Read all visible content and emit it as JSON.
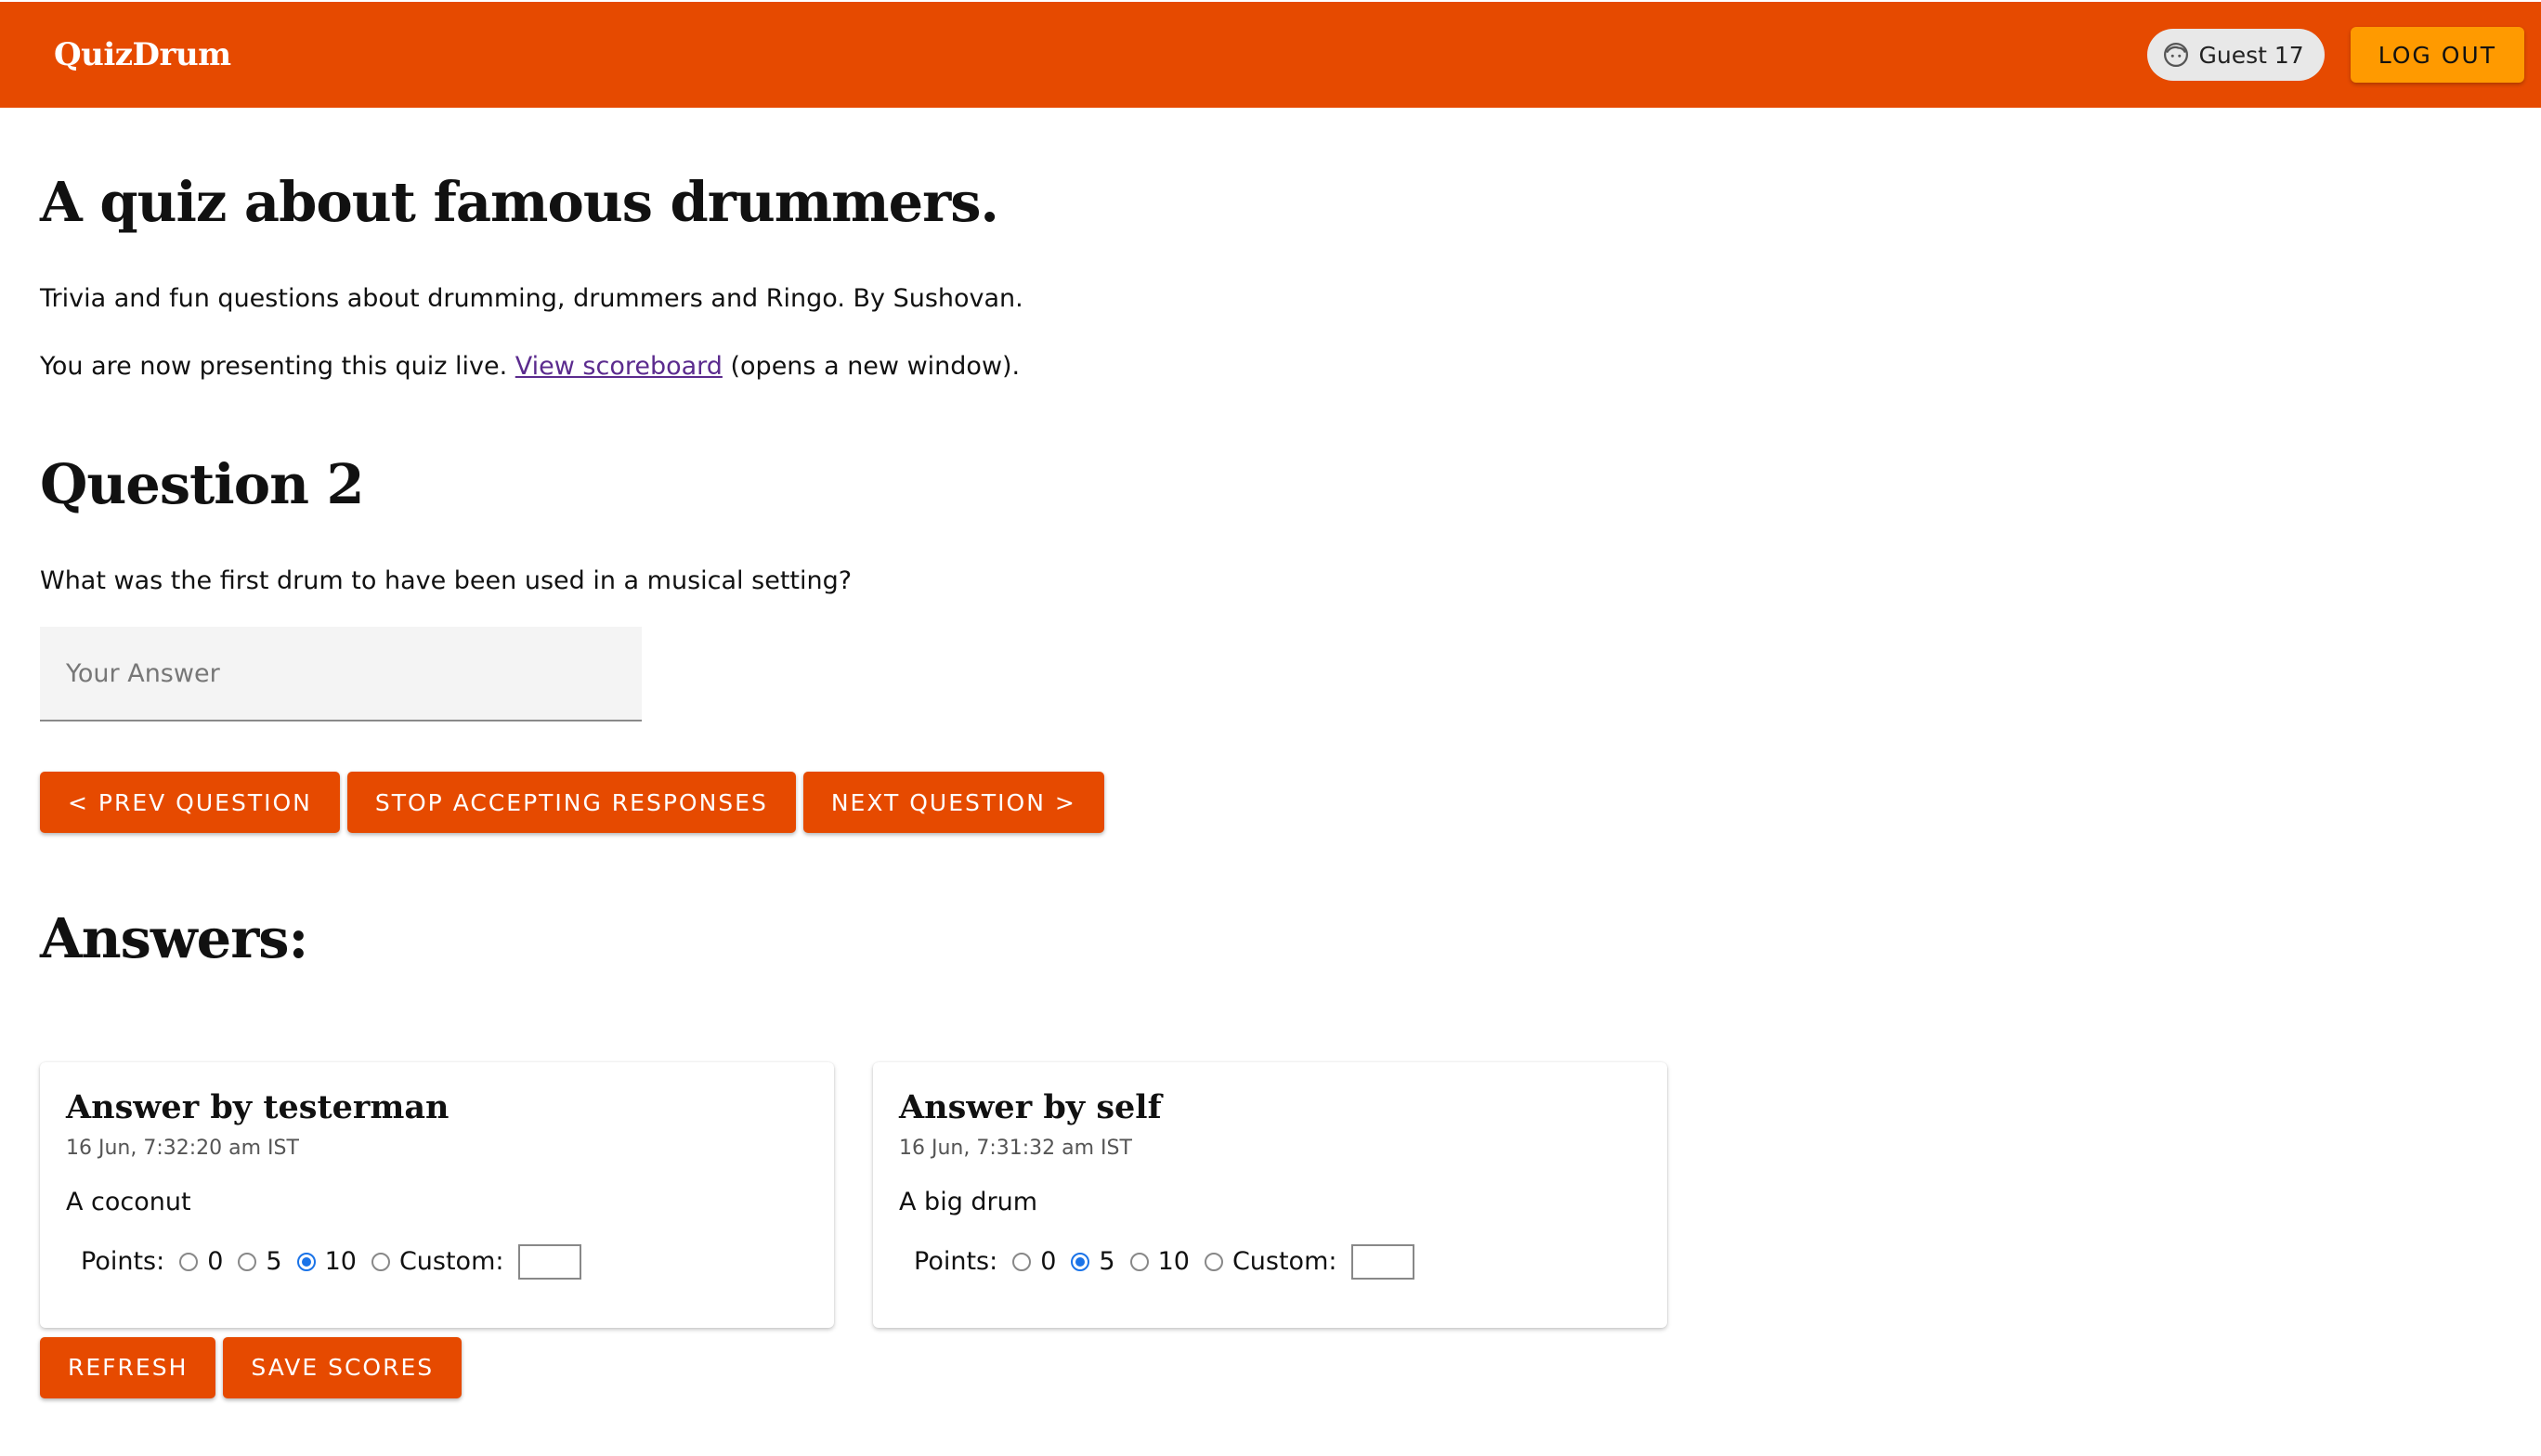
{
  "header": {
    "brand": "QuizDrum",
    "user_name": "Guest 17",
    "user_icon": "face-icon",
    "logout_label": "LOG OUT",
    "bar_color": "#e64a00",
    "logout_color": "#ff9a00"
  },
  "quiz": {
    "title": "A quiz about famous drummers.",
    "description": "Trivia and fun questions about drumming, drummers and Ringo. By Sushovan.",
    "live_prefix": "You are now presenting this quiz live. ",
    "scoreboard_link": "View scoreboard",
    "live_suffix": " (opens a new window)."
  },
  "question": {
    "title": "Question 2",
    "text": "What was the first drum to have been used in a musical setting?",
    "answer_placeholder": "Your Answer",
    "prev_label": "< PREV QUESTION",
    "stop_label": "STOP ACCEPTING RESPONSES",
    "next_label": "NEXT QUESTION >"
  },
  "answers": {
    "title": "Answers:",
    "points_label": "Points:",
    "custom_label": "Custom:",
    "items": [
      {
        "title": "Answer by testerman",
        "time": "16 Jun, 7:32:20 am IST",
        "answer": "A coconut",
        "options": [
          "0",
          "5",
          "10"
        ],
        "selected": "10"
      },
      {
        "title": "Answer by self",
        "time": "16 Jun, 7:31:32 am IST",
        "answer": "A big drum",
        "options": [
          "0",
          "5",
          "10"
        ],
        "selected": "5"
      }
    ],
    "refresh_label": "REFRESH",
    "save_label": "SAVE SCORES"
  }
}
